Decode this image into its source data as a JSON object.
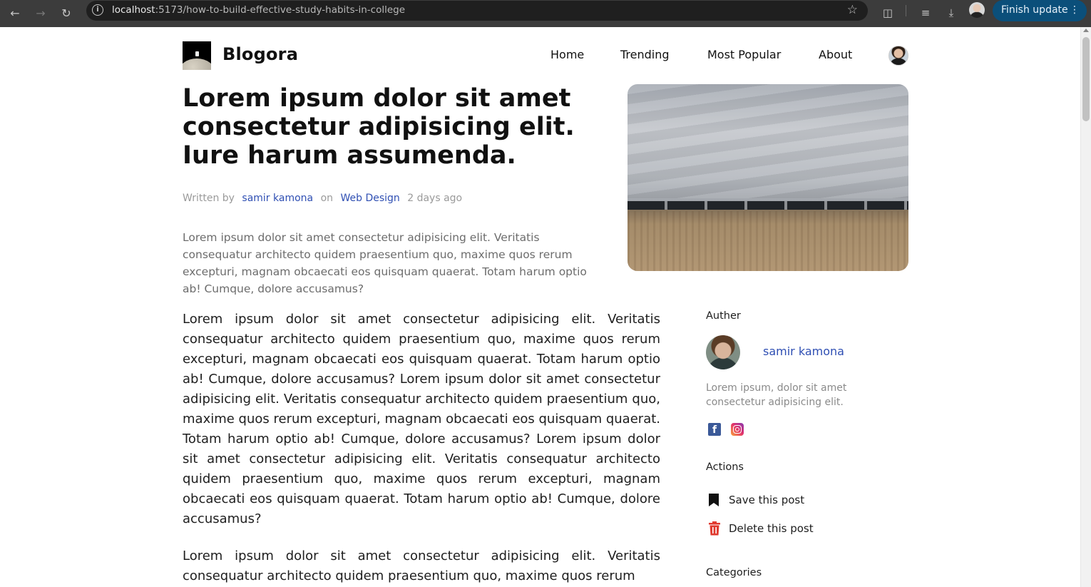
{
  "browser": {
    "url_host": "localhost",
    "url_path": ":5173/how-to-build-effective-study-habits-in-college",
    "update_button": "Finish update"
  },
  "site": {
    "brand": "Blogora",
    "nav": [
      "Home",
      "Trending",
      "Most Popular",
      "About"
    ]
  },
  "post": {
    "title": "Lorem ipsum dolor sit amet consectetur adipisicing elit. Iure harum assumenda.",
    "meta": {
      "written_by": "Written by",
      "author": "samir kamona",
      "on": "on",
      "category": "Web Design",
      "time": "2 days ago"
    },
    "excerpt": "Lorem ipsum dolor sit amet consectetur adipisicing elit. Veritatis consequatur architecto quidem praesentium quo, maxime quos rerum excepturi, magnam obcaecati eos quisquam quaerat. Totam harum optio ab! Cumque, dolore accusamus?",
    "paragraphs": [
      "Lorem ipsum dolor sit amet consectetur adipisicing elit. Veritatis consequatur architecto quidem praesentium quo, maxime quos rerum excepturi, magnam obcaecati eos quisquam quaerat. Totam harum optio ab! Cumque, dolore accusamus? Lorem ipsum dolor sit amet consectetur adipisicing elit. Veritatis consequatur architecto quidem praesentium quo, maxime quos rerum excepturi, magnam obcaecati eos quisquam quaerat. Totam harum optio ab! Cumque, dolore accusamus? Lorem ipsum dolor sit amet consectetur adipisicing elit. Veritatis consequatur architecto quidem praesentium quo, maxime quos rerum excepturi, magnam obcaecati eos quisquam quaerat. Totam harum optio ab! Cumque, dolore accusamus?",
      "Lorem ipsum dolor sit amet consectetur adipisicing elit. Veritatis consequatur architecto quidem praesentium quo, maxime quos rerum"
    ]
  },
  "sidebar": {
    "author_heading": "Auther",
    "author_name": "samir kamona",
    "author_bio": "Lorem ipsum, dolor sit amet consectetur adipisicing elit.",
    "actions_heading": "Actions",
    "save_label": "Save this post",
    "delete_label": "Delete this post",
    "categories_heading": "Categories"
  },
  "colors": {
    "link_blue": "#2f4fb3",
    "update_button_bg": "#0b4f7a",
    "delete_red": "#e03a2f"
  }
}
